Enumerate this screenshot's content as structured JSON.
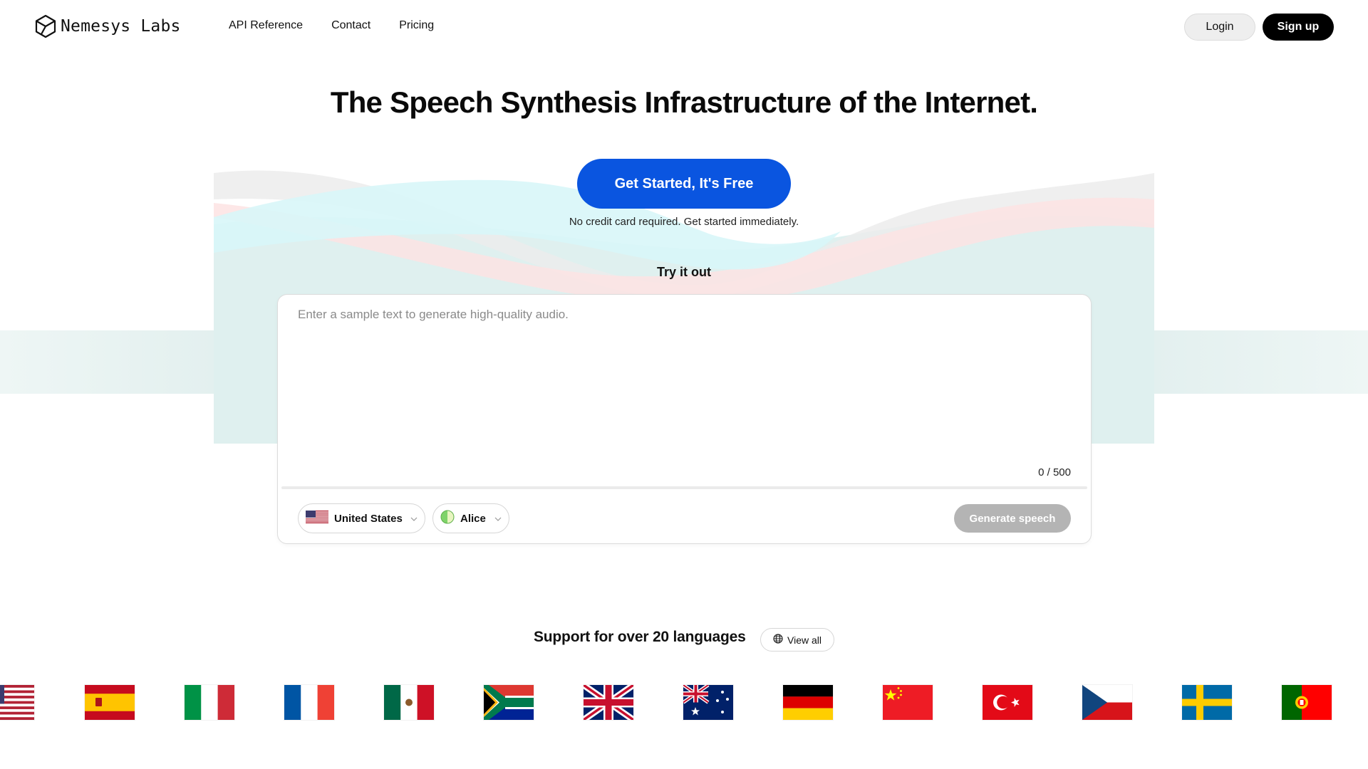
{
  "brand": {
    "name": "Nemesys Labs",
    "logo_icon": "hexagon-cube-icon"
  },
  "nav": [
    {
      "label": "API Reference"
    },
    {
      "label": "Contact"
    },
    {
      "label": "Pricing"
    }
  ],
  "auth": {
    "login_label": "Login",
    "signup_label": "Sign up"
  },
  "hero": {
    "title": "The Speech Synthesis Infrastructure of the Internet.",
    "cta_label": "Get Started, It's Free",
    "cta_note": "No credit card required. Get started immediately.",
    "try_label": "Try it out"
  },
  "demo": {
    "placeholder": "Enter a sample text to generate high-quality audio.",
    "value": "",
    "counter": "0 / 500",
    "country": "United States",
    "voice": "Alice",
    "generate_label": "Generate speech"
  },
  "languages": {
    "title": "Support for over 20 languages",
    "view_all_label": "View all",
    "flags": [
      "us",
      "es",
      "it",
      "fr",
      "mx",
      "za",
      "gb",
      "au",
      "de",
      "cn",
      "tr",
      "cz",
      "se",
      "pt"
    ]
  },
  "colors": {
    "cta": "#0a55e0",
    "signup": "#000000",
    "generate_disabled": "#b4b4b4",
    "wave_teal": "#dff0ef",
    "wave_cyan": "#dcf8fa",
    "wave_pink": "#fde6e6",
    "wave_gray": "#eeeeee"
  }
}
